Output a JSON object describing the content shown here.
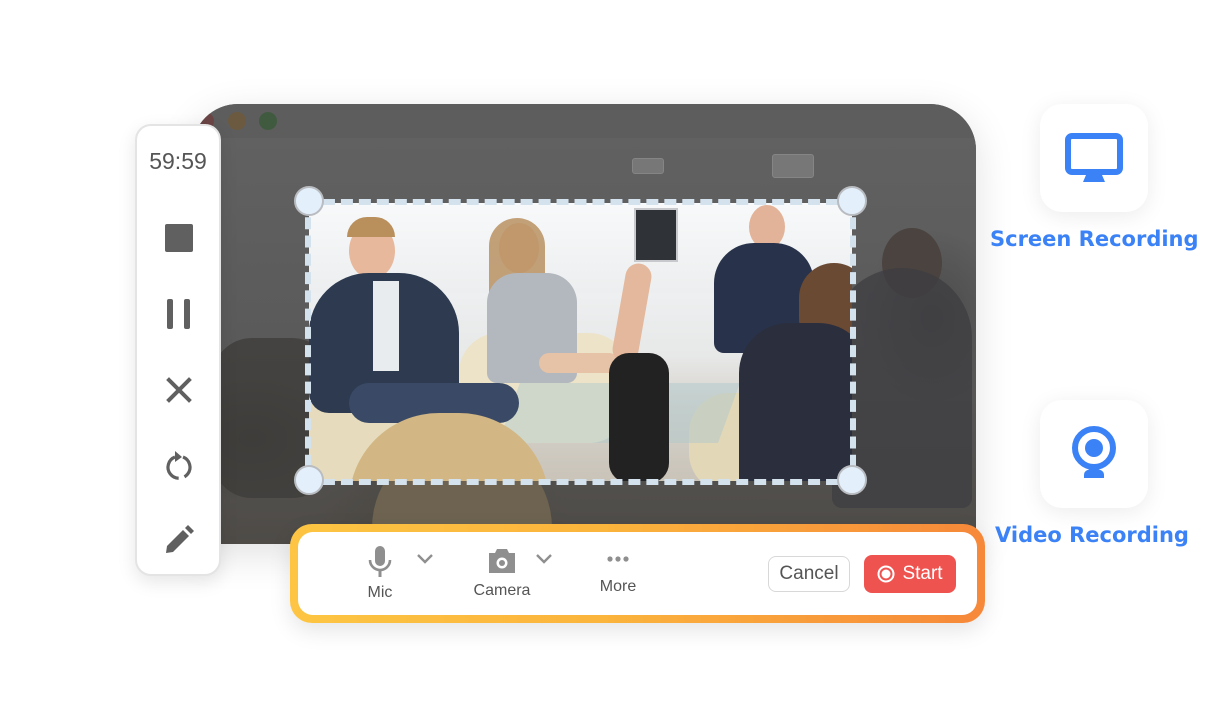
{
  "window": {
    "traffic_lights": [
      {
        "name": "close",
        "color": "#6b4545"
      },
      {
        "name": "minimize",
        "color": "#6b5a40"
      },
      {
        "name": "maximize",
        "color": "#405a40"
      }
    ]
  },
  "recorder_toolbar": {
    "timer": "59:59",
    "tools": [
      {
        "id": "stop",
        "icon": "stop-icon"
      },
      {
        "id": "pause",
        "icon": "pause-icon"
      },
      {
        "id": "discard",
        "icon": "close-icon"
      },
      {
        "id": "restart",
        "icon": "restart-icon"
      },
      {
        "id": "annotate",
        "icon": "pencil-icon"
      }
    ],
    "icon_color": "#606060"
  },
  "selection": {
    "border_color": "#d4e2ee",
    "handle_color": "#e3f0fc",
    "content": "office meeting photo"
  },
  "control_bar": {
    "items": [
      {
        "label": "Mic",
        "icon": "microphone-icon",
        "has_dropdown": true
      },
      {
        "label": "Camera",
        "icon": "camera-icon",
        "has_dropdown": true
      },
      {
        "label": "More",
        "icon": "more-dots-icon",
        "has_dropdown": false
      }
    ],
    "cancel_label": "Cancel",
    "start_label": "Start",
    "start_color": "#ef5350",
    "border_gradient": [
      "#fdc543",
      "#f6883a"
    ]
  },
  "modes": [
    {
      "label": "Screen Recording",
      "icon": "monitor-icon"
    },
    {
      "label": "Video Recording",
      "icon": "webcam-icon"
    }
  ],
  "accent_color": "#3b82f6"
}
